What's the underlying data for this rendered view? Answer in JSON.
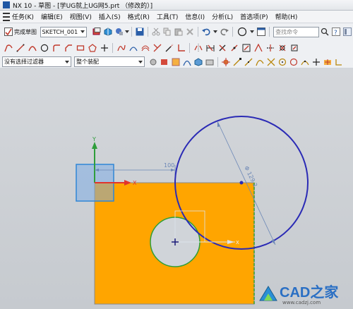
{
  "window": {
    "title": "NX 10 - 草图 - [学UG就上UG网5.prt （修改的）]"
  },
  "menu": {
    "tasks": "任务(K)",
    "items": [
      "编辑(E)",
      "视图(V)",
      "插入(S)",
      "格式(R)",
      "工具(T)",
      "信息(I)",
      "分析(L)",
      "首选项(P)",
      "帮助(H)"
    ]
  },
  "toolbar": {
    "finish_sketch_label": "完成草图",
    "sketch_name": "SKETCH_001",
    "search_placeholder": "查找命令"
  },
  "filters": {
    "selection_filter": "没有选择过滤器",
    "assembly_scope": "整个装配"
  },
  "sketch": {
    "dim_horizontal": "100",
    "dim_diameter": "Φ 129.2",
    "axis_x": "X",
    "axis_y": "Y",
    "cross_x": "X"
  },
  "watermark": {
    "brand": "CAD之家",
    "url": "www.cadzj.com"
  },
  "colors": {
    "face": "#ffa500",
    "circle": "#2a2ab5",
    "dimension": "#6b87b6",
    "csys_x": "#e1342c",
    "csys_y": "#2f9e3b"
  }
}
